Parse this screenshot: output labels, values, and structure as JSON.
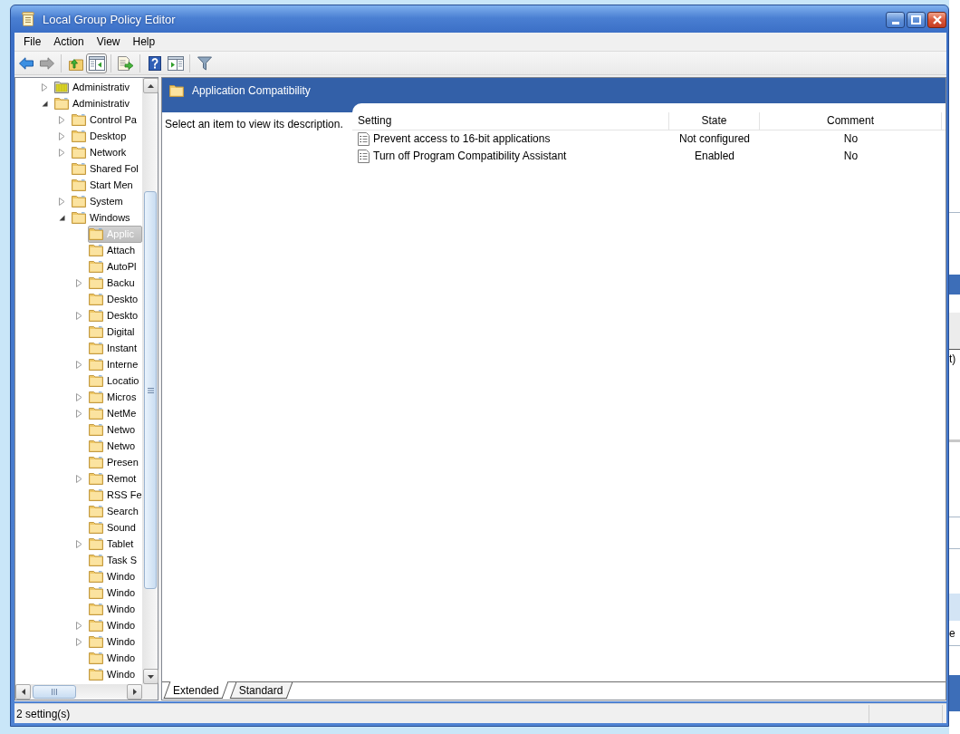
{
  "window": {
    "title": "Local Group Policy Editor"
  },
  "menu": [
    {
      "label": "File"
    },
    {
      "label": "Action"
    },
    {
      "label": "View"
    },
    {
      "label": "Help"
    }
  ],
  "toolbar": [
    [
      {
        "kind": "back",
        "disabled": false,
        "pressed": false
      },
      {
        "kind": "forward",
        "disabled": true,
        "pressed": false
      }
    ],
    [
      {
        "kind": "up",
        "disabled": false,
        "pressed": false
      },
      {
        "kind": "console-tree",
        "disabled": false,
        "pressed": true
      }
    ],
    [
      {
        "kind": "export",
        "disabled": false,
        "pressed": false
      }
    ],
    [
      {
        "kind": "help",
        "disabled": false,
        "pressed": false
      },
      {
        "kind": "action-pane",
        "disabled": false,
        "pressed": false
      }
    ],
    [
      {
        "kind": "filter",
        "disabled": false,
        "pressed": false
      }
    ]
  ],
  "tree": [
    {
      "label": "Administrativ",
      "kind": "policy-store",
      "expandable": true,
      "expanded": false,
      "selected": false
    },
    {
      "label": "Administrativ",
      "kind": "folder",
      "expandable": true,
      "expanded": true,
      "selected": false,
      "children": [
        {
          "label": "Control Pa",
          "expandable": true,
          "expanded": false,
          "selected": false
        },
        {
          "label": "Desktop",
          "expandable": true,
          "expanded": false,
          "selected": false
        },
        {
          "label": "Network",
          "expandable": true,
          "expanded": false,
          "selected": false
        },
        {
          "label": "Shared Fol",
          "expandable": false,
          "expanded": false,
          "selected": false
        },
        {
          "label": "Start Men",
          "expandable": false,
          "expanded": false,
          "selected": false
        },
        {
          "label": "System",
          "expandable": true,
          "expanded": false,
          "selected": false
        },
        {
          "label": "Windows",
          "expandable": true,
          "expanded": true,
          "selected": false,
          "children": [
            {
              "label": "Applic",
              "expandable": false,
              "expanded": false,
              "selected": true
            },
            {
              "label": "Attach",
              "expandable": false,
              "expanded": false,
              "selected": false
            },
            {
              "label": "AutoPl",
              "expandable": false,
              "expanded": false,
              "selected": false
            },
            {
              "label": "Backu",
              "expandable": true,
              "expanded": false,
              "selected": false
            },
            {
              "label": "Deskto",
              "expandable": false,
              "expanded": false,
              "selected": false
            },
            {
              "label": "Deskto",
              "expandable": true,
              "expanded": false,
              "selected": false
            },
            {
              "label": "Digital",
              "expandable": false,
              "expanded": false,
              "selected": false
            },
            {
              "label": "Instant",
              "expandable": false,
              "expanded": false,
              "selected": false
            },
            {
              "label": "Interne",
              "expandable": true,
              "expanded": false,
              "selected": false
            },
            {
              "label": "Locatio",
              "expandable": false,
              "expanded": false,
              "selected": false
            },
            {
              "label": "Micros",
              "expandable": true,
              "expanded": false,
              "selected": false
            },
            {
              "label": "NetMe",
              "expandable": true,
              "expanded": false,
              "selected": false
            },
            {
              "label": "Netwo",
              "expandable": false,
              "expanded": false,
              "selected": false
            },
            {
              "label": "Netwo",
              "expandable": false,
              "expanded": false,
              "selected": false
            },
            {
              "label": "Presen",
              "expandable": false,
              "expanded": false,
              "selected": false
            },
            {
              "label": "Remot",
              "expandable": true,
              "expanded": false,
              "selected": false
            },
            {
              "label": "RSS Fe",
              "expandable": false,
              "expanded": false,
              "selected": false
            },
            {
              "label": "Search",
              "expandable": false,
              "expanded": false,
              "selected": false
            },
            {
              "label": "Sound",
              "expandable": false,
              "expanded": false,
              "selected": false
            },
            {
              "label": "Tablet",
              "expandable": true,
              "expanded": false,
              "selected": false
            },
            {
              "label": "Task S",
              "expandable": false,
              "expanded": false,
              "selected": false
            },
            {
              "label": "Windo",
              "expandable": false,
              "expanded": false,
              "selected": false
            },
            {
              "label": "Windo",
              "expandable": false,
              "expanded": false,
              "selected": false
            },
            {
              "label": "Windo",
              "expandable": false,
              "expanded": false,
              "selected": false
            },
            {
              "label": "Windo",
              "expandable": true,
              "expanded": false,
              "selected": false
            },
            {
              "label": "Windo",
              "expandable": true,
              "expanded": false,
              "selected": false
            },
            {
              "label": "Windo",
              "expandable": false,
              "expanded": false,
              "selected": false
            },
            {
              "label": "Windo",
              "expandable": false,
              "expanded": false,
              "selected": false
            }
          ]
        }
      ]
    }
  ],
  "details": {
    "title": "Application Compatibility",
    "description": "Select an item to view its description.",
    "columns": [
      {
        "label": "Setting"
      },
      {
        "label": "State"
      },
      {
        "label": "Comment"
      }
    ],
    "rows": [
      {
        "cells": [
          "Prevent access to 16-bit applications",
          "Not configured",
          "No"
        ],
        "selected": false
      },
      {
        "cells": [
          "Turn off Program Compatibility Assistant",
          "Enabled",
          "No"
        ],
        "selected": false
      }
    ]
  },
  "view_tabs": [
    {
      "label": "Extended",
      "selected": true
    },
    {
      "label": "Standard",
      "selected": false
    }
  ],
  "status_bar": {
    "text": "2 setting(s)"
  },
  "background_window": {
    "fragments": [
      "t)",
      "e"
    ]
  }
}
